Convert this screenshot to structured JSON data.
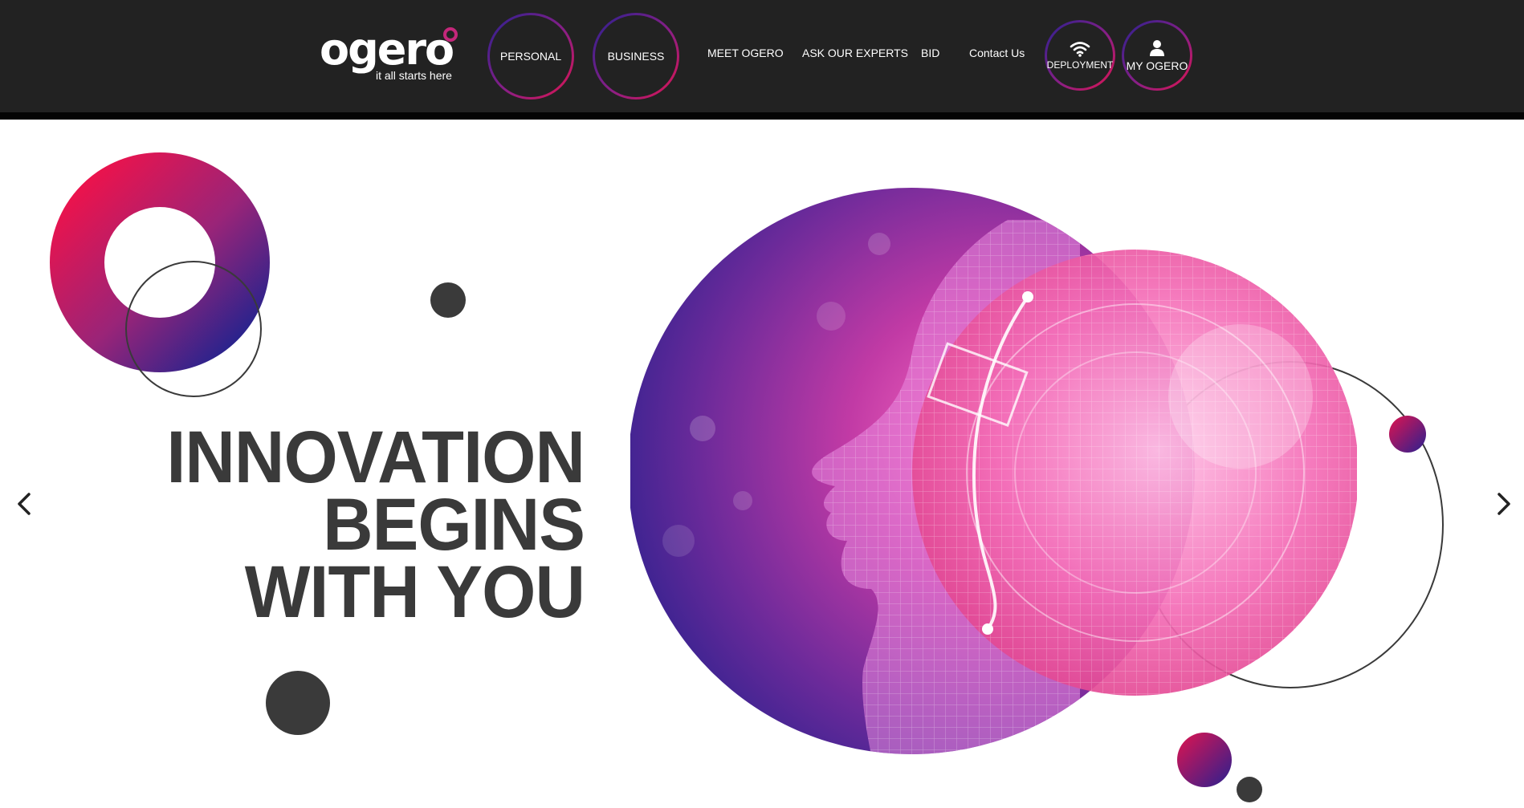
{
  "header": {
    "logo": {
      "wordmark": "ogero",
      "tagline": "it all starts here"
    },
    "ring_buttons": {
      "personal": "PERSONAL",
      "business": "BUSINESS"
    },
    "nav_links": {
      "meet": "MEET OGERO",
      "ask": "ASK OUR EXPERTS",
      "bid": "BID",
      "contact": "Contact Us"
    },
    "icon_buttons": {
      "deployment": {
        "label": "DEPLOYMENT",
        "icon": "wifi-icon"
      },
      "my_ogero": {
        "label": "MY OGERO",
        "icon": "user-icon"
      }
    }
  },
  "hero": {
    "headline": [
      "INNOVATION",
      "BEGINS",
      "WITH YOU"
    ]
  },
  "carousel": {
    "prev_icon": "chevron-left-icon",
    "next_icon": "chevron-right-icon"
  },
  "colors": {
    "header_bg": "#222222",
    "headline": "#3a3a3a",
    "accent_pink": "#e0144f",
    "accent_purple": "#8a1f86",
    "accent_blue": "#2a2090",
    "dark_dot": "#3a3a3a"
  }
}
